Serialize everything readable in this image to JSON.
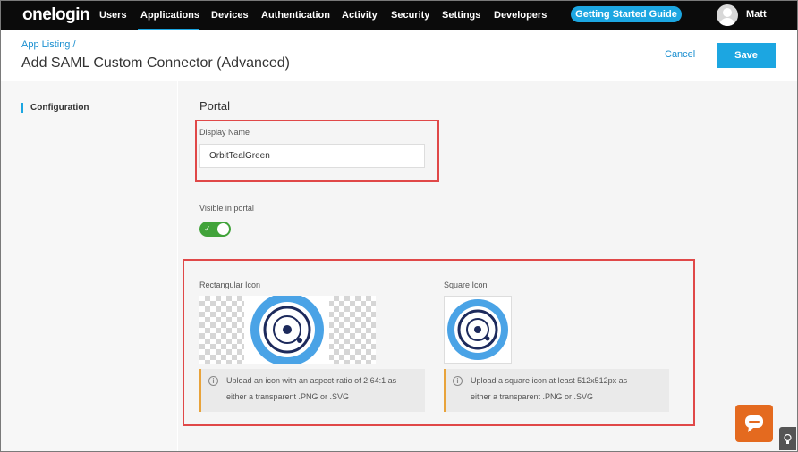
{
  "nav": {
    "logo": "onelogin",
    "items": [
      "Users",
      "Applications",
      "Devices",
      "Authentication",
      "Activity",
      "Security",
      "Settings",
      "Developers"
    ],
    "active": "Applications",
    "guide_button": "Getting Started Guide",
    "user": "Matt"
  },
  "header": {
    "breadcrumb": "App Listing /",
    "title": "Add SAML Custom Connector (Advanced)",
    "cancel": "Cancel",
    "save": "Save"
  },
  "sidebar": {
    "items": [
      {
        "label": "Configuration",
        "active": true
      }
    ]
  },
  "portal": {
    "title": "Portal",
    "display_name_label": "Display Name",
    "display_name_value": "OrbitTealGreen",
    "visible_label": "Visible in portal",
    "visible_on": true
  },
  "icons": {
    "rect_label": "Rectangular Icon",
    "rect_info_line1": "Upload an icon with an aspect-ratio of 2.64:1 as",
    "rect_info_line2": "either a transparent .PNG or .SVG",
    "square_label": "Square Icon",
    "square_info_line1": "Upload a square icon at least 512x512px as",
    "square_info_line2": "either a transparent .PNG or .SVG"
  },
  "colors": {
    "accent": "#1ca6e1",
    "toggle_on": "#41a33a",
    "highlight": "#e04848",
    "orbit_blue": "#4aa3e6",
    "orbit_navy": "#1d2a5c",
    "chat": "#e46a1f"
  },
  "icon_names": {
    "info": "info-icon",
    "chat": "chat-bubble-icon",
    "bulb": "lightbulb-icon",
    "avatar": "user-avatar-icon",
    "check": "check-icon"
  }
}
